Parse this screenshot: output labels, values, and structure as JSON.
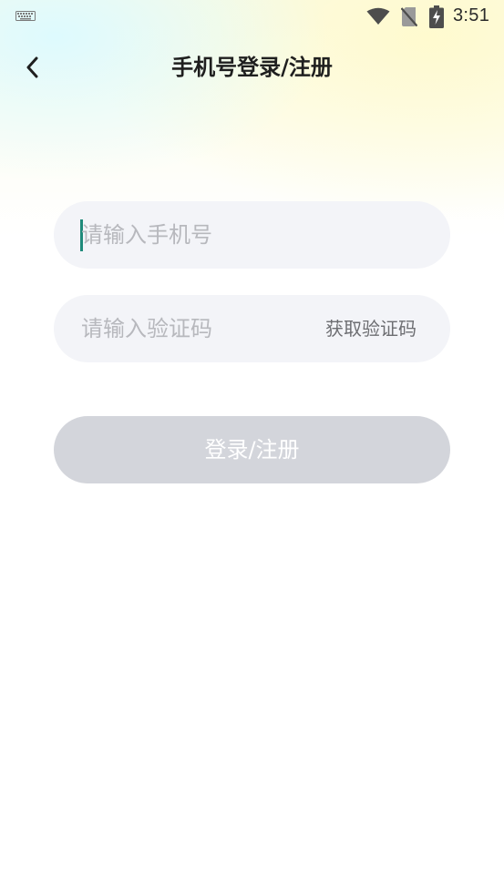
{
  "status_bar": {
    "time": "3:51",
    "icons": [
      "keyboard-icon",
      "wifi-icon",
      "no-sim-icon",
      "battery-charging-icon"
    ]
  },
  "header": {
    "back_icon": "chevron-left-icon",
    "title": "手机号登录/注册"
  },
  "form": {
    "phone": {
      "value": "",
      "placeholder": "请输入手机号"
    },
    "code": {
      "value": "",
      "placeholder": "请输入验证码",
      "get_code_label": "获取验证码"
    },
    "submit_label": "登录/注册"
  },
  "colors": {
    "caret": "#1e8a7a",
    "field_bg": "#f3f4f8",
    "button_disabled_bg": "#d3d5db",
    "placeholder": "#b7b8bd"
  }
}
